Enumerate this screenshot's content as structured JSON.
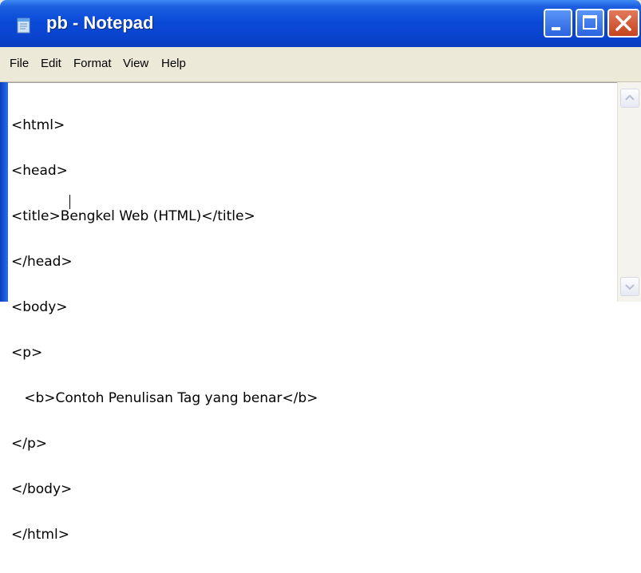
{
  "window": {
    "title": "pb - Notepad"
  },
  "menu": [
    "File",
    "Edit",
    "Format",
    "View",
    "Help"
  ],
  "editor": {
    "lines": [
      "<html>",
      "<head>",
      "<title>Bengkel Web (HTML)</title>",
      "</head>",
      "<body>",
      "<p>",
      "   <b>Contoh Penulisan Tag yang benar</b>",
      "</p>",
      "</body>",
      "</html>"
    ]
  },
  "colors": {
    "titlebar": "#0a44cf",
    "close_button": "#c6431e",
    "menubar": "#ece9d8"
  },
  "icons": {
    "app": "notepad-icon",
    "minimize": "minimize-icon",
    "maximize": "maximize-icon",
    "close": "close-icon",
    "scroll_up": "chevron-up-icon",
    "scroll_down": "chevron-down-icon"
  }
}
